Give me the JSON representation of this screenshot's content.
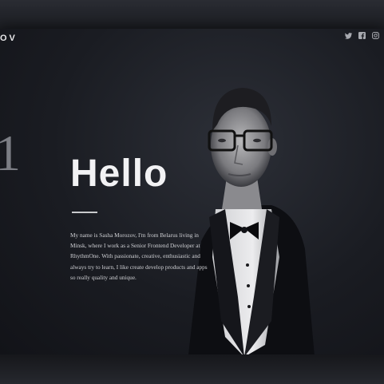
{
  "header": {
    "brand_text": "OV",
    "social": [
      {
        "icon": "twitter-icon",
        "glyph": "tw"
      },
      {
        "icon": "facebook-icon",
        "glyph": "fb"
      },
      {
        "icon": "instagram-icon",
        "glyph": "ig"
      }
    ]
  },
  "hero": {
    "slide_number": "1",
    "title": "Hello",
    "intro": "My name is Sasha Morozov, I'm from Belarus living in Minsk, where I work as a Senior Frontend Developer at RhythmOne. With passionate, creative, enthusiastic and always try to learn, I like create develop products and apps so really quality and unique."
  },
  "colors": {
    "background": "#1f2127",
    "title": "#f2f2f4",
    "text": "#cfd0d4"
  }
}
